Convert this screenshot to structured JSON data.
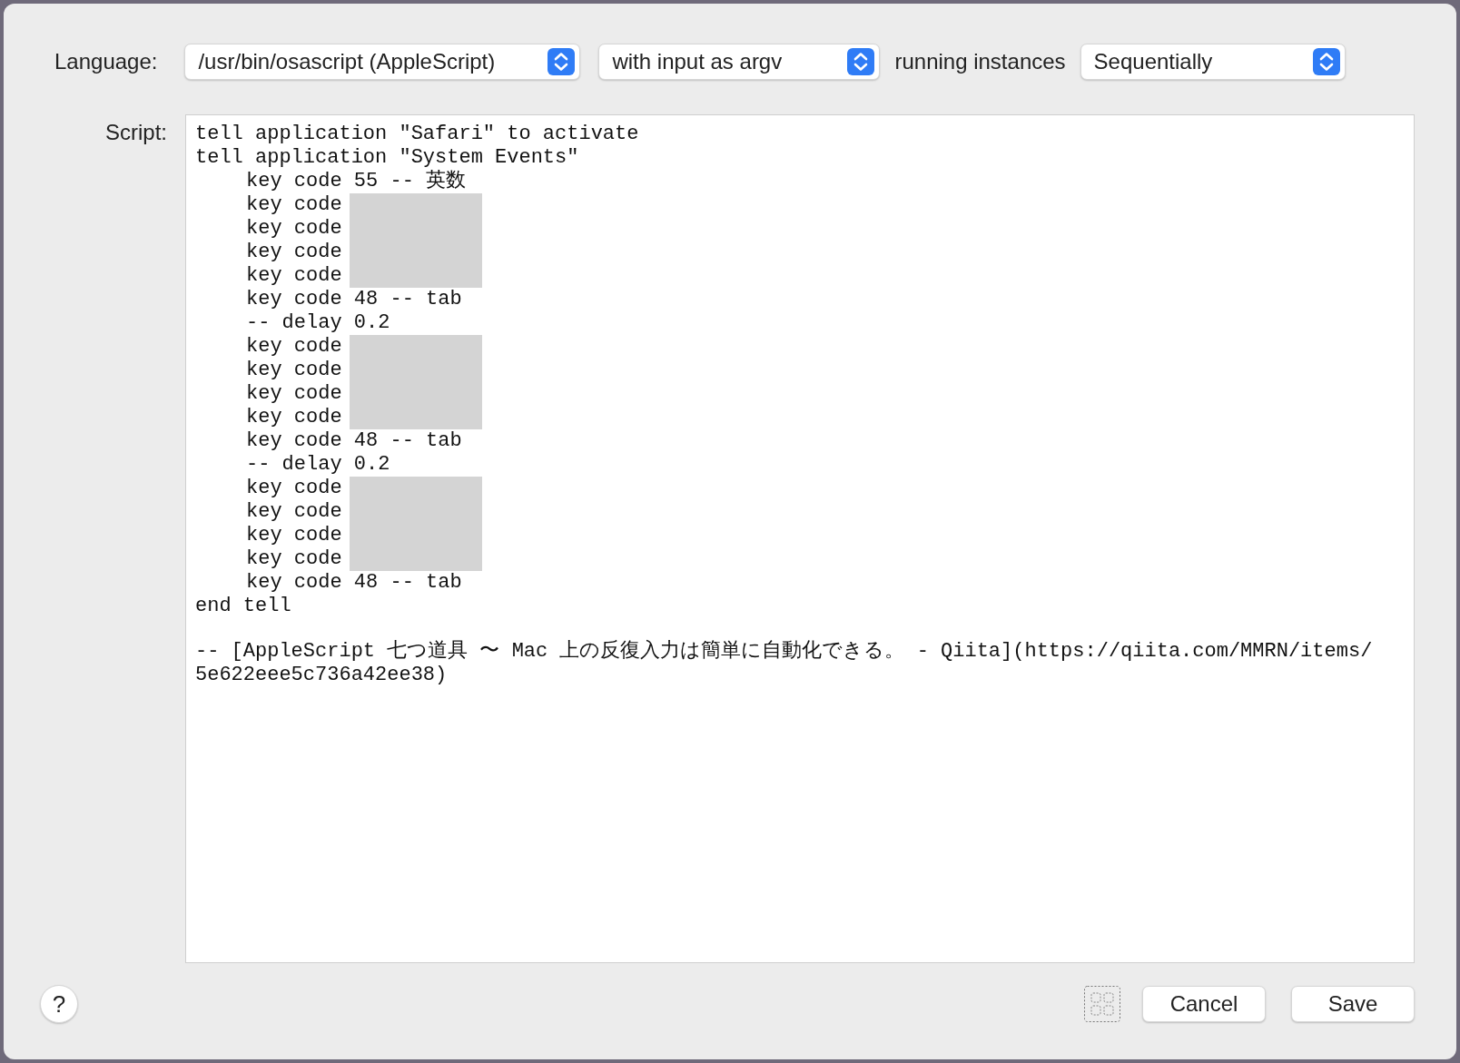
{
  "language_row": {
    "label": "Language:",
    "popups": [
      {
        "value": "/usr/bin/osascript (AppleScript)"
      },
      {
        "value": "with input as argv"
      },
      {
        "value": "Sequentially"
      }
    ],
    "between_label": "running instances"
  },
  "script": {
    "label": "Script:",
    "blocks": [
      {
        "lines": [
          {
            "text": "tell application \"Safari\" to activate",
            "indented": false,
            "redacted": false
          },
          {
            "text": "tell application \"System Events\"",
            "indented": false,
            "redacted": false
          },
          {
            "text": "key code 55 -- 英数",
            "indented": true,
            "redacted": false
          },
          {
            "text": "key code",
            "indented": true,
            "redacted": true
          },
          {
            "text": "key code",
            "indented": true,
            "redacted": true
          },
          {
            "text": "key code",
            "indented": true,
            "redacted": true
          },
          {
            "text": "key code",
            "indented": true,
            "redacted": true
          },
          {
            "text": "key code 48 -- tab",
            "indented": true,
            "redacted": false
          },
          {
            "text": "-- delay 0.2",
            "indented": true,
            "redacted": false
          },
          {
            "text": "key code",
            "indented": true,
            "redacted": true
          },
          {
            "text": "key code",
            "indented": true,
            "redacted": true
          },
          {
            "text": "key code",
            "indented": true,
            "redacted": true
          },
          {
            "text": "key code",
            "indented": true,
            "redacted": true
          },
          {
            "text": "key code 48 -- tab",
            "indented": true,
            "redacted": false
          },
          {
            "text": "-- delay 0.2",
            "indented": true,
            "redacted": false
          },
          {
            "text": "key code",
            "indented": true,
            "redacted": true
          },
          {
            "text": "key code",
            "indented": true,
            "redacted": true
          },
          {
            "text": "key code",
            "indented": true,
            "redacted": true
          },
          {
            "text": "key code",
            "indented": true,
            "redacted": true
          },
          {
            "text": "key code 48 -- tab",
            "indented": true,
            "redacted": false
          },
          {
            "text": "end tell",
            "indented": false,
            "redacted": false
          }
        ]
      },
      {
        "lines": [
          {
            "text": "-- [AppleScript 七つ道具 〜 Mac 上の反復入力は簡単に自動化できる。 - Qiita](https://qiita.com/MMRN/items/",
            "indented": false,
            "redacted": false
          },
          {
            "text": "5e622eee5c736a42ee38)",
            "indented": false,
            "redacted": false
          }
        ]
      }
    ]
  },
  "footer": {
    "help": "?",
    "buttons": [
      "Cancel",
      "Save"
    ]
  }
}
